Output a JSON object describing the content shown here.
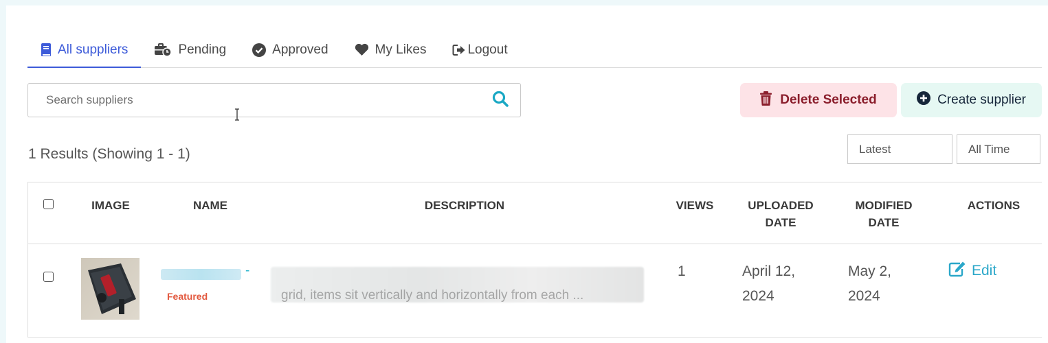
{
  "tabs": [
    {
      "label": "All suppliers",
      "icon": "book-icon",
      "active": true
    },
    {
      "label": "Pending",
      "icon": "briefcase-clock-icon",
      "active": false
    },
    {
      "label": "Approved",
      "icon": "check-circle-icon",
      "active": false
    },
    {
      "label": "My Likes",
      "icon": "heart-icon",
      "active": false
    },
    {
      "label": "Logout",
      "icon": "logout-icon",
      "active": false
    }
  ],
  "search": {
    "placeholder": "Search suppliers",
    "value": ""
  },
  "actions": {
    "delete_label": "Delete Selected",
    "create_label": "Create supplier"
  },
  "results_text": "1 Results (Showing 1 - 1)",
  "filters": {
    "sort": "Latest",
    "time": "All Time"
  },
  "table": {
    "headers": {
      "image": "IMAGE",
      "name": "NAME",
      "description": "DESCRIPTION",
      "views": "VIEWS",
      "uploaded_1": "UPLOADED",
      "uploaded_2": "DATE",
      "modified_1": "MODIFIED",
      "modified_2": "DATE",
      "actions": "ACTIONS"
    },
    "rows": [
      {
        "name_suffix": "-",
        "badge": "Featured",
        "description": "grid, items sit vertically and horizontally from each ...",
        "views": "1",
        "uploaded_1": "April 12,",
        "uploaded_2": "2024",
        "modified_1": "May 2,",
        "modified_2": "2024",
        "action_label": "Edit"
      }
    ]
  },
  "colors": {
    "accent": "#3d5bd9",
    "search_icon": "#1aa8c4",
    "delete_bg": "#fde3e7",
    "delete_text": "#8b1e2c",
    "create_bg": "#e6f8f3",
    "featured": "#e2583e",
    "edit": "#2aa7c9"
  }
}
